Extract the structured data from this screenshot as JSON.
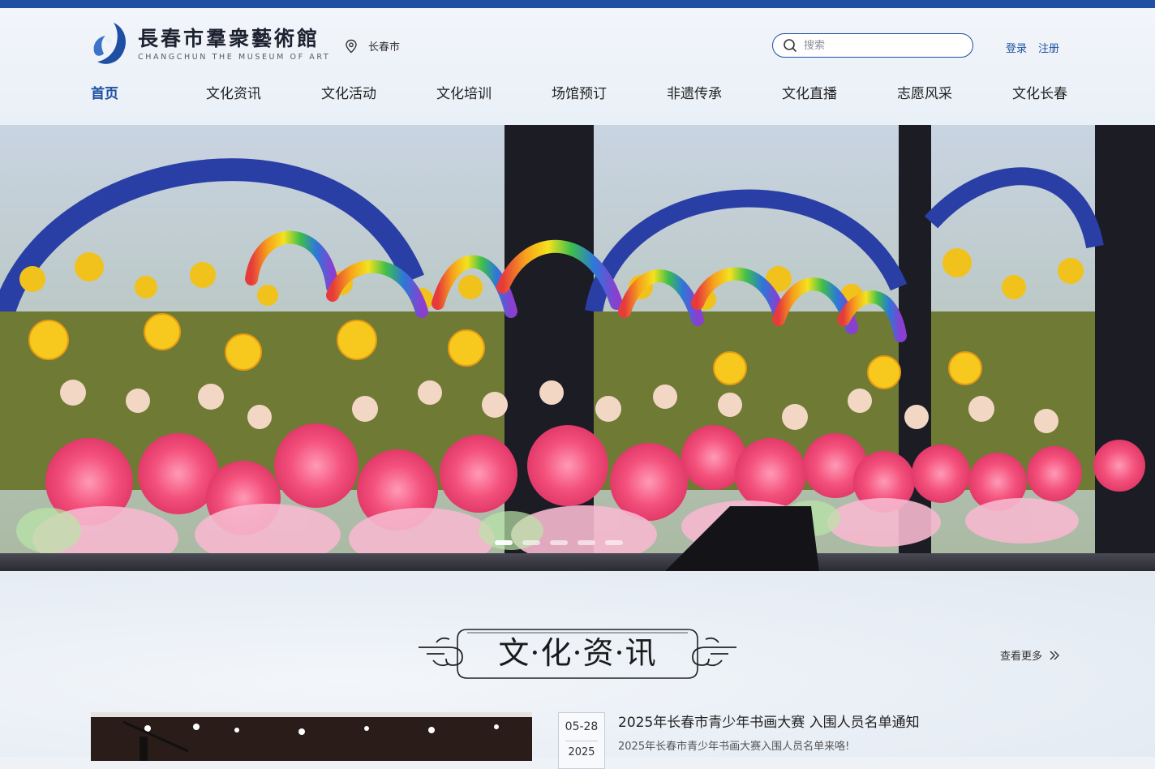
{
  "header": {
    "logo_cn": "長春市羣衆藝術館",
    "logo_en": "CHANGCHUN  THE  MUSEUM  OF  ART",
    "location": "长春市",
    "search_placeholder": "搜索",
    "login": "登录",
    "register": "注册"
  },
  "nav": {
    "items": [
      "首页",
      "文化资讯",
      "文化活动",
      "文化培训",
      "场馆预订",
      "非遗传承",
      "文化直播",
      "志愿风采",
      "文化长春"
    ],
    "active_index": 0
  },
  "hero": {
    "slide_count": 5,
    "active_slide": 0
  },
  "section": {
    "title": "文·化·资·讯",
    "more": "查看更多"
  },
  "news": {
    "date_md": "05-28",
    "date_year": "2025",
    "title": "2025年长春市青少年书画大赛 入围人员名单通知",
    "desc": "2025年长春市青少年书画大赛入围人员名单来咯!"
  },
  "colors": {
    "brand": "#1e4fa3",
    "text": "#222222",
    "petal": "#f4517c"
  }
}
